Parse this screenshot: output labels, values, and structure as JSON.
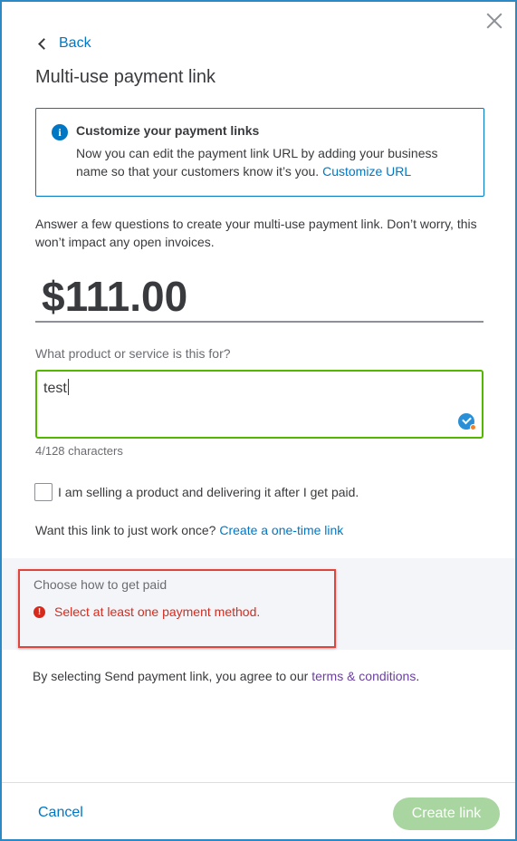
{
  "header": {
    "back_label": "Back",
    "title": "Multi-use payment link"
  },
  "info": {
    "title": "Customize your payment links",
    "body": "Now you can edit the payment link URL by adding your business name so that your customers know it’s you.",
    "link": "Customize URL"
  },
  "intro": "Answer a few questions to create your multi-use payment link. Don’t worry, this won’t impact any open invoices.",
  "amount": "$111.00",
  "product": {
    "label": "What product or service is this for?",
    "value": "test",
    "counter": "4/128 characters"
  },
  "delivery_checkbox": {
    "label": "I am selling a product and delivering it after I get paid.",
    "checked": false
  },
  "once": {
    "text": "Want this link to just work once?",
    "link": "Create a one-time link"
  },
  "payment": {
    "title": "Choose how to get paid",
    "error": "Select at least one payment method."
  },
  "terms": {
    "text": "By selecting Send payment link, you agree to our",
    "link": "terms & conditions",
    "suffix": "."
  },
  "footer": {
    "cancel_label": "Cancel",
    "create_label": "Create link"
  },
  "colors": {
    "accent": "#0077c5",
    "success_border": "#53b700",
    "error": "#d52b1e",
    "create_button_disabled": "#a9d5a0"
  }
}
